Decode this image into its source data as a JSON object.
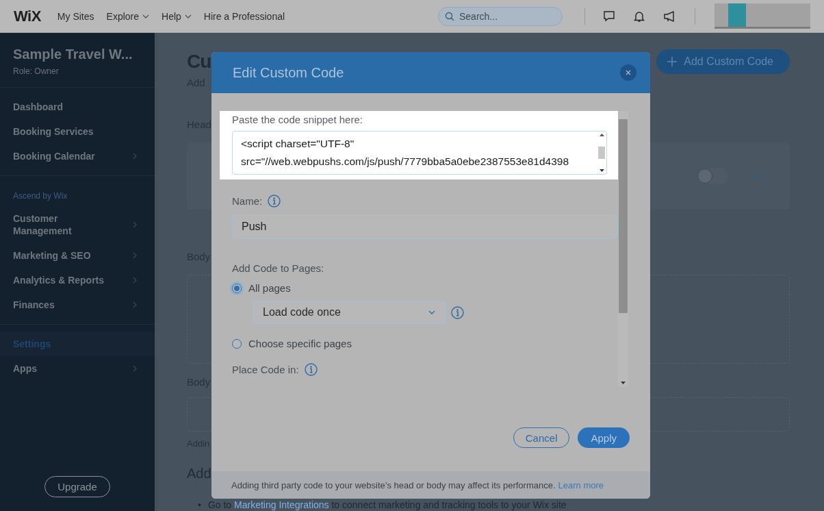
{
  "topbar": {
    "logo": "WiX",
    "nav": [
      {
        "label": "My Sites",
        "dropdown": false
      },
      {
        "label": "Explore",
        "dropdown": true
      },
      {
        "label": "Help",
        "dropdown": true
      },
      {
        "label": "Hire a Professional",
        "dropdown": false
      }
    ],
    "search": {
      "placeholder": "Search..."
    }
  },
  "sidebar": {
    "site_name": "Sample Travel W...",
    "role": "Role: Owner",
    "groups": [
      {
        "items": [
          {
            "label": "Dashboard",
            "arrow": false,
            "selected": false
          },
          {
            "label": "Booking Services",
            "arrow": false,
            "selected": false
          },
          {
            "label": "Booking Calendar",
            "arrow": true,
            "selected": false
          }
        ]
      },
      {
        "heading": "Ascend by Wix",
        "items": [
          {
            "label": "Customer Management",
            "arrow": true,
            "selected": false
          },
          {
            "label": "Marketing & SEO",
            "arrow": true,
            "selected": false
          },
          {
            "label": "Analytics & Reports",
            "arrow": true,
            "selected": false
          },
          {
            "label": "Finances",
            "arrow": true,
            "selected": false
          }
        ]
      },
      {
        "items": [
          {
            "label": "Settings",
            "arrow": false,
            "selected": true
          },
          {
            "label": "Apps",
            "arrow": true,
            "selected": false
          }
        ]
      }
    ],
    "upgrade_button": "Upgrade"
  },
  "page": {
    "title": "Cu",
    "subtitle": "Add",
    "add_button": "Add Custom Code",
    "head_label": "Head",
    "head_toggle": {
      "on": false
    },
    "body_label_1": "Body",
    "body_label_2": "Body",
    "note": "Addin",
    "section_heading": "Add",
    "bullet": {
      "marker": "•",
      "before": "Go to ",
      "link": "Marketing Integrations",
      "after": " to connect marketing and tracking tools to your Wix site"
    }
  },
  "modal": {
    "title": "Edit Custom Code",
    "snippet_label": "Paste the code snippet here:",
    "snippet_lines": [
      "<script charset=\"UTF-8\"",
      "src=\"//web.webpushs.com/js/push/7779bba5a0ebe2387553e81d4398"
    ],
    "name_label": "Name:",
    "name_value": "Push",
    "pages_label": "Add Code to Pages:",
    "options": [
      {
        "label": "All pages",
        "selected": true
      },
      {
        "label": "Choose specific pages",
        "selected": false
      }
    ],
    "load_select": "Load code once",
    "place_label": "Place Code in:",
    "cancel": "Cancel",
    "apply": "Apply",
    "footer_text": "Adding third party code to your website’s head or body may affect its performance.",
    "footer_link": "Learn more"
  }
}
